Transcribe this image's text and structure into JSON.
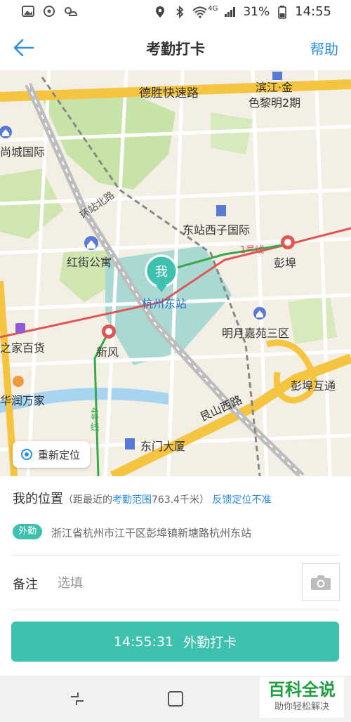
{
  "status_bar": {
    "battery": "31%",
    "time": "14:55",
    "network": "4G",
    "icons": [
      "image-icon",
      "sync-icon",
      "weather-icon",
      "location-icon",
      "bluetooth-icon",
      "wifi-icon",
      "signal-icon",
      "battery-icon"
    ]
  },
  "header": {
    "title": "考勤打卡",
    "help": "帮助",
    "back_icon": "back-arrow-icon"
  },
  "map": {
    "labels": {
      "road_desheng": "德胜快速路",
      "binjiang": "滨江·金",
      "selimingsq": "色黎明2期",
      "chengguoji": "尚城国际",
      "huanzhanbeilu": "环站北路",
      "dongzhanxizi": "东站西子国际",
      "hongjie": "红街公寓",
      "line1": "1号线",
      "pengbu": "彭埠",
      "hangzhoudong": "杭州东站",
      "mingyue": "明月嘉苑三区",
      "zhijia": "之家百货",
      "xinfeng": "新风",
      "pengbuhutong": "彭埠互通",
      "runwanjia": "华润万家",
      "line4": "4号线",
      "genshan": "艮山西路",
      "dongmen": "东门大厦"
    },
    "me_marker": "我",
    "relocate_label": "重新定位"
  },
  "info": {
    "my_location": "我的位置",
    "paren_open": "（距最近的",
    "range_link": "考勤范围",
    "distance": "763.4千米）",
    "feedback_link": "反馈定位不准",
    "badge": "外勤",
    "address": "浙江省杭州市江干区彭埠镇新塘路杭州东站",
    "remark_label": "备注",
    "remark_placeholder": "选填",
    "camera_icon": "camera-icon"
  },
  "punch": {
    "time": "14:55:31",
    "label": "外勤打卡"
  },
  "watermark": {
    "title": "百科全说",
    "subtitle": "助你轻松解决"
  },
  "colors": {
    "accent": "#3fc1b0",
    "link": "#2b8fe3",
    "road_major": "#f5c542",
    "metro_line1": "#e05555",
    "metro_line4": "#3aa84a"
  }
}
